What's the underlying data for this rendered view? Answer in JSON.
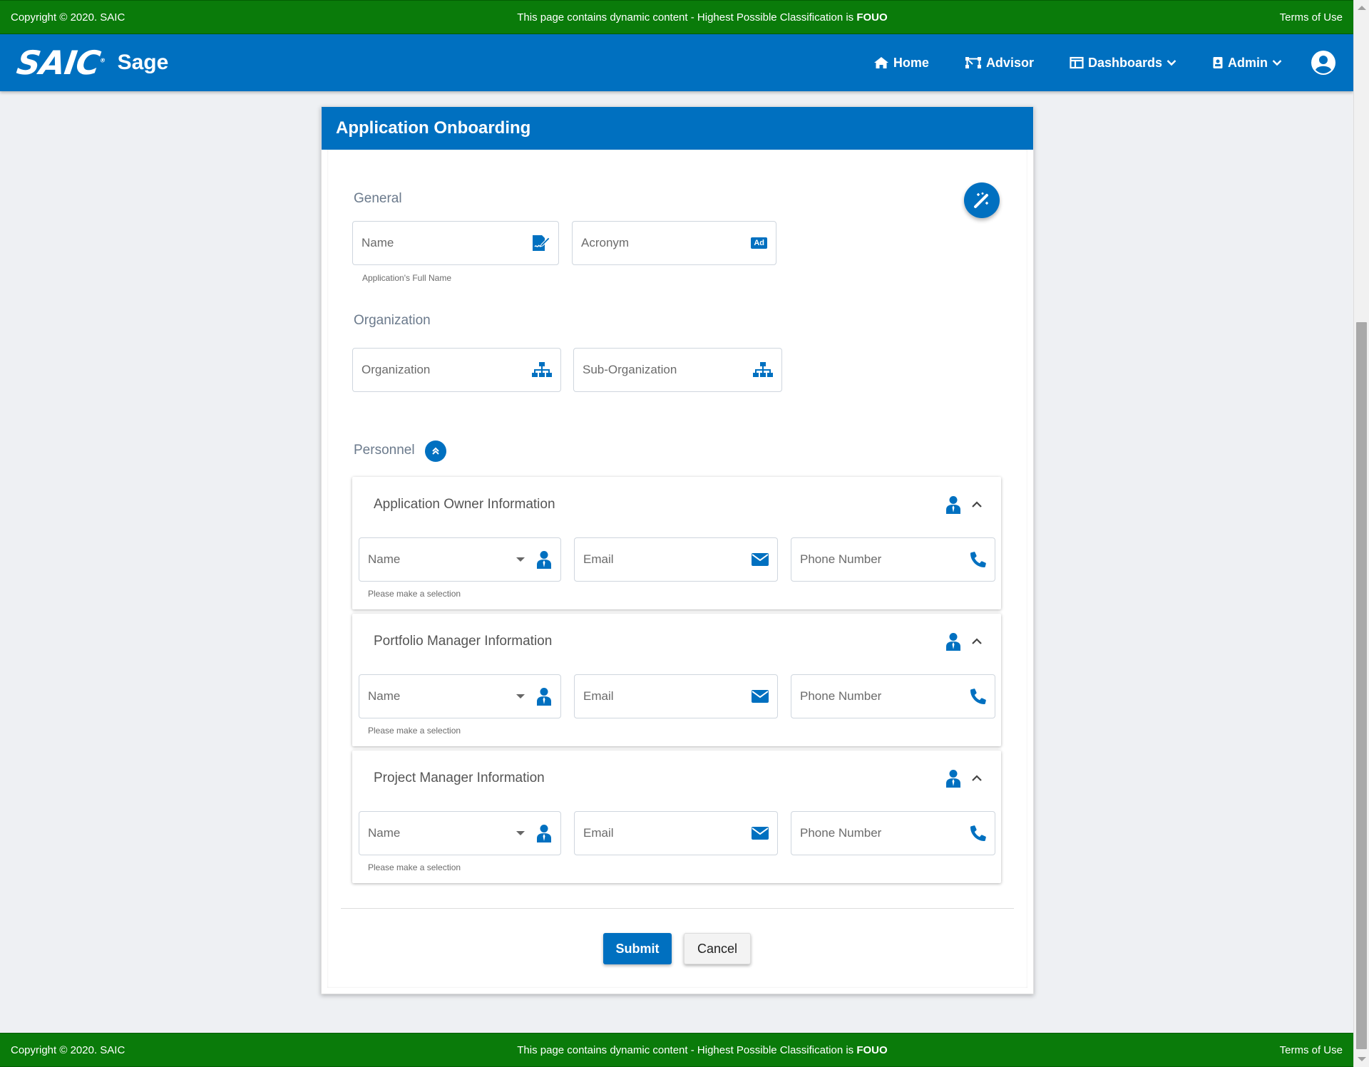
{
  "classification_bar": {
    "copyright": "Copyright © 2020. SAIC",
    "message_prefix": "This page contains dynamic content - Highest Possible Classification is ",
    "message_level": "FOUO",
    "terms": "Terms of Use"
  },
  "navbar": {
    "logo": "SAIC",
    "app_name": "Sage",
    "items": [
      {
        "label": "Home",
        "icon": "home-icon"
      },
      {
        "label": "Advisor",
        "icon": "advisor-icon"
      },
      {
        "label": "Dashboards",
        "icon": "dashboard-icon",
        "dropdown": true
      },
      {
        "label": "Admin",
        "icon": "badge-icon",
        "dropdown": true
      }
    ],
    "user_icon": "user-circle-icon"
  },
  "card": {
    "title": "Application Onboarding",
    "general": {
      "label": "General",
      "name_placeholder": "Name",
      "name_hint": "Application's Full Name",
      "acronym_placeholder": "Acronym",
      "acronym_badge": "Ad"
    },
    "organization": {
      "label": "Organization",
      "org_placeholder": "Organization",
      "suborg_placeholder": "Sub-Organization"
    },
    "personnel": {
      "label": "Personnel",
      "panels": [
        {
          "title": "Application Owner Information",
          "name_placeholder": "Name",
          "email_placeholder": "Email",
          "phone_placeholder": "Phone Number",
          "hint": "Please make a selection"
        },
        {
          "title": "Portfolio Manager Information",
          "name_placeholder": "Name",
          "email_placeholder": "Email",
          "phone_placeholder": "Phone Number",
          "hint": "Please make a selection"
        },
        {
          "title": "Project Manager Information",
          "name_placeholder": "Name",
          "email_placeholder": "Email",
          "phone_placeholder": "Phone Number",
          "hint": "Please make a selection"
        }
      ]
    },
    "submit_label": "Submit",
    "cancel_label": "Cancel"
  },
  "colors": {
    "classification_green": "#0a7b0a",
    "brand_blue": "#0070c0",
    "background": "#eef0f3"
  }
}
